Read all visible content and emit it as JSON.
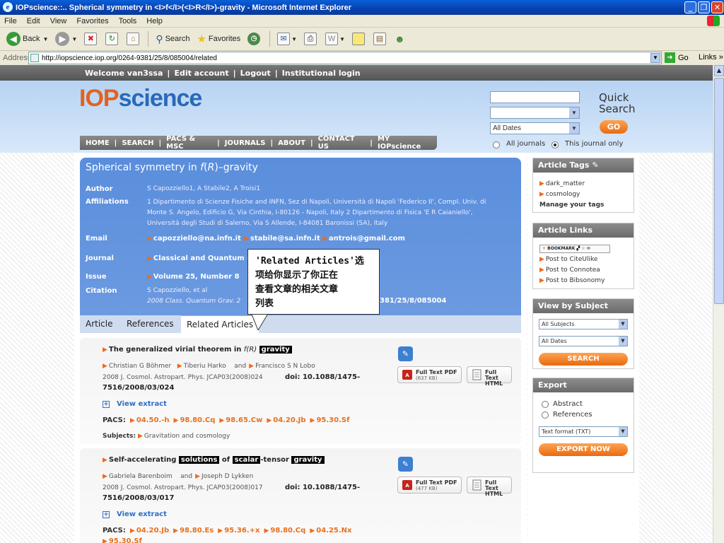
{
  "window": {
    "title": "IOPscience::.. Spherical symmetry in <I>f</I>(<I>R</I>)-gravity - Microsoft Internet Explorer",
    "controls": [
      "_",
      "❐",
      "✕"
    ]
  },
  "menu": [
    "File",
    "Edit",
    "View",
    "Favorites",
    "Tools",
    "Help"
  ],
  "toolbar": {
    "back": "Back",
    "search": "Search",
    "favorites": "Favorites"
  },
  "address": {
    "label": "Address",
    "url": "http://iopscience.iop.org/0264-9381/25/8/085004/related",
    "go": "Go",
    "links": "Links"
  },
  "site": {
    "topstrip": [
      "Welcome van3ssa",
      "|",
      "Edit account",
      "|",
      "Logout",
      "|",
      "Institutional login"
    ],
    "logo_iop": "IOP",
    "logo_science": "science",
    "nav": [
      "HOME",
      "|",
      "SEARCH",
      "|",
      "PACS & MSC",
      "|",
      "JOURNALS",
      "|",
      "ABOUT",
      "|",
      "CONTACT US",
      "|",
      "MY IOPscience"
    ],
    "quick_search": {
      "line1": "Quick",
      "line2": "Search",
      "dates": "All Dates",
      "go": "GO",
      "all_journals": "All journals",
      "this_journal": "This journal only"
    }
  },
  "article": {
    "title_pre": "Spherical symmetry in ",
    "title_f": "f",
    "title_paren": "(",
    "title_R": "R",
    "title_post": ")–gravity",
    "labels": {
      "author": "Author",
      "affiliations": "Affiliations",
      "email": "Email",
      "journal": "Journal",
      "issue": "Issue",
      "citation": "Citation"
    },
    "authors": "S Capozziello1, A Stabile2, A Troisi1",
    "affil_line1": "1 Dipartimento di Scienze Fisiche and INFN, Sez di Napoli, Università di Napoli 'Federico II', Compl. Univ. di",
    "affil_line2": "Monte S. Angelo, Edificio G, Via Cinthia, I-80126 - Napoli, Italy 2 Dipartimento di Fisica 'E R Caianiello',",
    "affil_line3": "Università degli Studi di Salerno, Via S Allende, I-84081 Baronissi (SA), Italy",
    "emails": [
      "capozziello@na.infn.it",
      "stabile@sa.infn.it",
      "antrois@gmail.com"
    ],
    "journal": "Classical and Quantum G",
    "issue": "Volume 25, Number 8",
    "citation_line1": "S Capozziello,  et al",
    "citation_line2": "2008 Class. Quantum Grav. 2",
    "citation_doi": "381/25/8/085004"
  },
  "tabs": [
    "Article",
    "References",
    "Related Articles"
  ],
  "callout": {
    "line1": "'Related Articles'选",
    "line2": "项给你显示了你正在",
    "line3": "查看文章的相关文章",
    "line4": "列表"
  },
  "results": [
    {
      "title_pre": "The generalized virial theorem in ",
      "title_f": "f(R)",
      "title_hl": "gravity",
      "authors": [
        "Christian G Böhmer",
        "Tiberiu Harko",
        "and",
        "Francisco S N Lobo"
      ],
      "journal_line": "2008 J. Cosmol. Astropart. Phys. JCAP03(2008)024",
      "doi_label": "doi:",
      "doi_a": "10.1088/1475-",
      "doi_b": "7516/2008/03/024",
      "view_extract": "View extract",
      "pacs_label": "PACS:",
      "pacs": [
        "04.50.-h",
        "98.80.Cq",
        "98.65.Cw",
        "04.20.Jb",
        "95.30.Sf"
      ],
      "subjects_label": "Subjects:",
      "subjects": "Gravitation and cosmology",
      "pdf_label": "Full Text PDF",
      "pdf_size": "(637 KB)",
      "html_label1": "Full Text",
      "html_label2": "HTML"
    },
    {
      "title_pre": "Self-accelerating ",
      "hl1": "solutions",
      "mid": " of ",
      "hl2": "scalar",
      "mid2": "-tensor ",
      "hl3": "gravity",
      "authors": [
        "Gabriela Barenboim",
        "and",
        "Joseph D Lykken"
      ],
      "journal_line": "2008 J. Cosmol. Astropart. Phys. JCAP03(2008)017",
      "doi_label": "doi:",
      "doi_a": "10.1088/1475-",
      "doi_b": "7516/2008/03/017",
      "view_extract": "View extract",
      "pacs_label": "PACS:",
      "pacs": [
        "04.20.Jb",
        "98.80.Es",
        "95.36.+x",
        "98.80.Cq",
        "04.25.Nx",
        "95.30.Sf"
      ],
      "pdf_label": "Full Text PDF",
      "pdf_size": "(477 KB)",
      "html_label1": "Full Text",
      "html_label2": "HTML"
    }
  ],
  "sidebar": {
    "tags": {
      "title": "Article Tags",
      "items": [
        "dark_matter",
        "cosmology"
      ],
      "manage": "Manage your tags"
    },
    "links": {
      "title": "Article Links",
      "bookmark": "BOOKMARK",
      "items": [
        "Post to CiteUlike",
        "Post to Connotea",
        "Post to Bibsonomy"
      ]
    },
    "subject": {
      "title": "View by Subject",
      "subjects": "All Subjects",
      "dates": "All Dates",
      "search": "SEARCH"
    },
    "export": {
      "title": "Export",
      "abstract": "Abstract",
      "references": "References",
      "format": "Text format (TXT)",
      "button": "EXPORT NOW"
    }
  },
  "colors": {
    "brand_blue": "#2a69b8",
    "brand_orange": "#e2621f",
    "article_bg": "#5a8edc",
    "pacs_orange": "#e8701c"
  }
}
